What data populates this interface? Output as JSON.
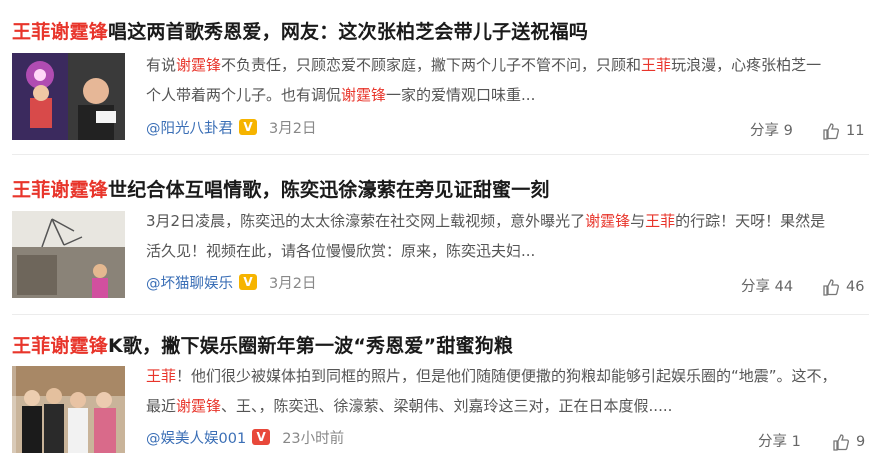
{
  "articles": [
    {
      "title_hl": "王菲谢霆锋",
      "title_rest": "唱这两首歌秀恩爱，网友：这次张柏芝会带儿子送祝福吗",
      "line1_a": "有说",
      "line1_hl1": "谢霆锋",
      "line1_b": "不负责任，只顾恋爱不顾家庭，撇下两个儿子不管不问，只顾和",
      "line1_hl2": "王菲",
      "line1_c": "玩浪漫，心疼张柏芝一",
      "line2_a": "个人带着两个儿子。也有调侃",
      "line2_hl": "谢霆锋",
      "line2_b": "一家的爱情观口味重...",
      "author": "@阳光八卦君",
      "badge": "V",
      "date": "3月2日",
      "share": "分享 9",
      "likes": "11"
    },
    {
      "title_hl": "王菲谢霆锋",
      "title_rest": "世纪合体互唱情歌，陈奕迅徐濠萦在旁见证甜蜜一刻",
      "line1_a": "3月2日凌晨，陈奕迅的太太徐濠萦在社交网上载视频，意外曝光了",
      "line1_hl1": "谢霆锋",
      "line1_b": "与",
      "line1_hl2": "王菲",
      "line1_c": "的行踪！天呀！果然是",
      "line2_a": "活久见！视频在此，请各位慢慢欣赏：原来，陈奕迅夫妇...",
      "line2_hl": "",
      "line2_b": "",
      "author": "@坏猫聊娱乐",
      "badge": "V",
      "date": "3月2日",
      "share": "分享 44",
      "likes": "46"
    },
    {
      "title_hl": "王菲谢霆锋",
      "title_rest": "K歌，撇下娱乐圈新年第一波“秀恩爱”甜蜜狗粮",
      "line1_a": "",
      "line1_hl1": "王菲",
      "line1_b": "！他们很少被媒体拍到同框的照片，但是他们随随便便撒的狗粮却能够引起娱乐圈的“地震”。这不，",
      "line1_hl2": "",
      "line1_c": "",
      "line2_a": "最近",
      "line2_hl": "谢霆锋",
      "line2_b": "、王、，陈奕迅、徐濠萦、梁朝伟、刘嘉玲这三对，正在日本度假.....",
      "author": "@娱美人娱001",
      "badge": "V",
      "date": "23小时前",
      "share": "分享 1",
      "likes": "9"
    }
  ],
  "colors": {
    "highlight": "#e8352b",
    "author": "#3b6fb6",
    "badge_gold": "#f6b400",
    "badge_red": "#e8483a"
  }
}
